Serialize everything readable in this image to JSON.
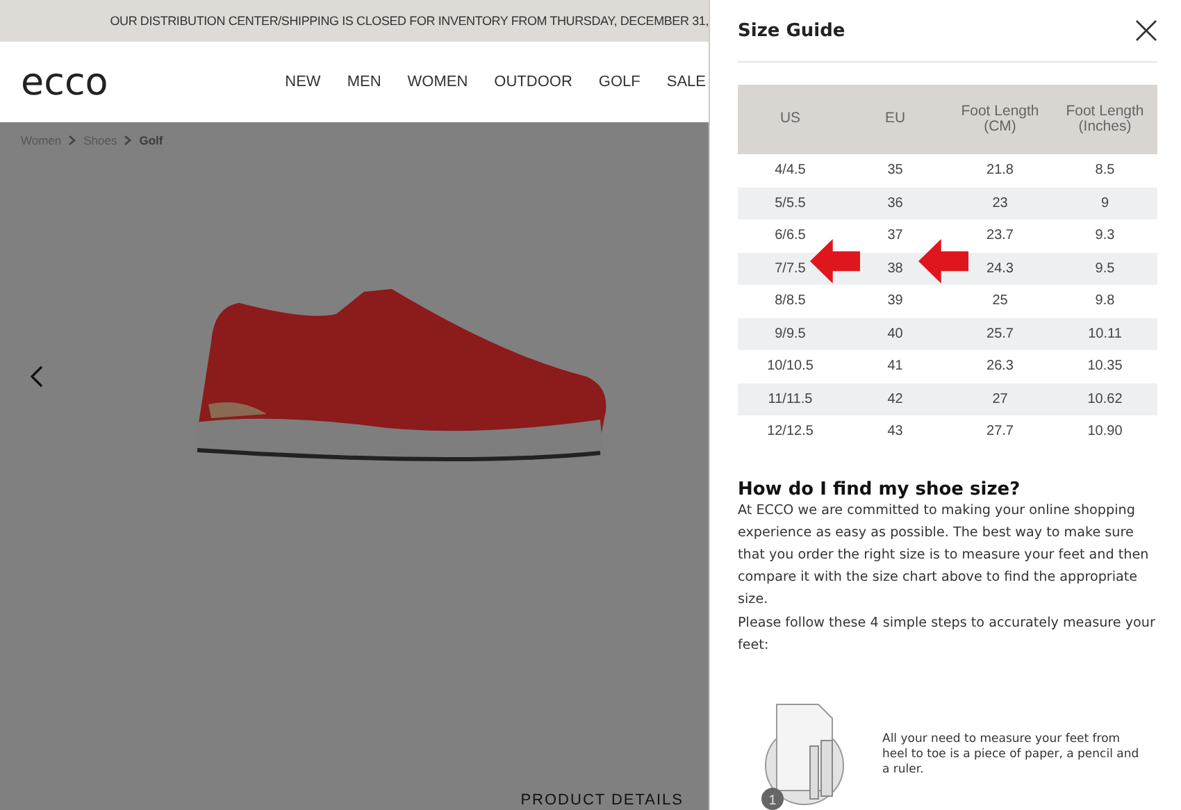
{
  "banner": {
    "text": "OUR DISTRIBUTION CENTER/SHIPPING IS CLOSED FOR INVENTORY FROM THURSDAY, DECEMBER 31,"
  },
  "header": {
    "logo": "ecco",
    "nav": [
      "NEW",
      "MEN",
      "WOMEN",
      "OUTDOOR",
      "GOLF",
      "SALE"
    ]
  },
  "breadcrumb": [
    {
      "label": "Women",
      "current": false
    },
    {
      "label": "Shoes",
      "current": false
    },
    {
      "label": "Golf",
      "current": true
    }
  ],
  "product": {
    "section_heading": "PRODUCT DETAILS"
  },
  "size_guide": {
    "title": "Size Guide",
    "table": {
      "columns": [
        "US",
        "EU",
        "Foot Length (CM)",
        "Foot Length (Inches)"
      ],
      "rows": [
        {
          "cells": [
            "4/4.5",
            "35",
            "21.8",
            "8.5"
          ],
          "marked": false
        },
        {
          "cells": [
            "5/5.5",
            "36",
            "23",
            "9"
          ],
          "marked": false
        },
        {
          "cells": [
            "6/6.5",
            "37",
            "23.7",
            "9.3"
          ],
          "marked": false
        },
        {
          "cells": [
            "7/7.5",
            "38",
            "24.3",
            "9.5"
          ],
          "marked": true
        },
        {
          "cells": [
            "8/8.5",
            "39",
            "25",
            "9.8"
          ],
          "marked": false
        },
        {
          "cells": [
            "9/9.5",
            "40",
            "25.7",
            "10.11"
          ],
          "marked": false
        },
        {
          "cells": [
            "10/10.5",
            "41",
            "26.3",
            "10.35"
          ],
          "marked": false
        },
        {
          "cells": [
            "11/11.5",
            "42",
            "27",
            "10.62"
          ],
          "marked": false
        },
        {
          "cells": [
            "12/12.5",
            "43",
            "27.7",
            "10.90"
          ],
          "marked": false
        }
      ]
    },
    "help_heading": "How do I find my shoe size?",
    "paragraphs": [
      "At ECCO we are committed to making your online shopping experience as easy as possible. The best way to make sure that you order the right size is to measure your feet and then compare it with the size chart above to find the appropriate size.",
      "Please follow these 4 simple steps to accurately measure your feet:"
    ],
    "steps": [
      {
        "number": "1",
        "text": "All your need to measure your feet from heel to toe is a piece of paper, a pencil and a ruler."
      }
    ]
  }
}
